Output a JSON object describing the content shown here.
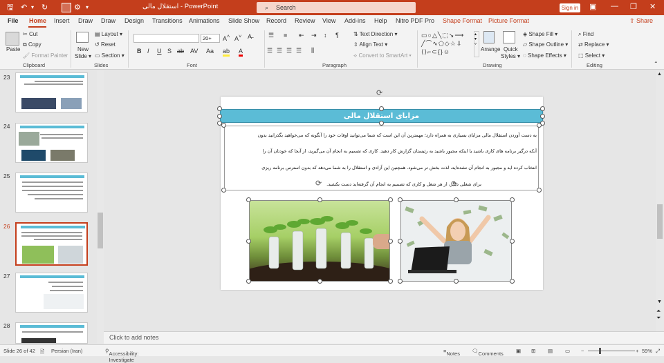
{
  "titlebar": {
    "doc_title": "استقلال مالی",
    "app": "PowerPoint",
    "search_placeholder": "Search",
    "signin": "Sign in"
  },
  "tabs": [
    "File",
    "Home",
    "Insert",
    "Draw",
    "Draw",
    "Design",
    "Transitions",
    "Animations",
    "Slide Show",
    "Record",
    "Review",
    "View",
    "Add-ins",
    "Help",
    "Nitro PDF Pro",
    "Shape Format",
    "Picture Format"
  ],
  "share": "Share",
  "ribbon": {
    "clipboard": {
      "paste": "Paste",
      "cut": "Cut",
      "copy": "Copy",
      "format_painter": "Format Painter",
      "label": "Clipboard"
    },
    "slides": {
      "new_slide": "New",
      "new_slide2": "Slide",
      "layout": "Layout",
      "reset": "Reset",
      "section": "Section",
      "label": "Slides"
    },
    "font": {
      "size": "20+",
      "label": "Font"
    },
    "paragraph": {
      "text_direction": "Text Direction",
      "align_text": "Align Text",
      "smartart": "Convert to SmartArt",
      "label": "Paragraph"
    },
    "drawing": {
      "arrange": "Arrange",
      "quick_styles": "Quick",
      "quick_styles2": "Styles",
      "shape_fill": "Shape Fill",
      "shape_outline": "Shape Outline",
      "shape_effects": "Shape Effects",
      "label": "Drawing"
    },
    "editing": {
      "find": "Find",
      "replace": "Replace",
      "select": "Select",
      "label": "Editing"
    }
  },
  "slides_panel": [
    {
      "num": "23"
    },
    {
      "num": "24"
    },
    {
      "num": "25"
    },
    {
      "num": "26"
    },
    {
      "num": "27"
    },
    {
      "num": "28"
    }
  ],
  "slide": {
    "title": "مزایای استقلال مالی",
    "lines": [
      "به دست آوردن استقلال مالی مزایای بسیاری به همراه دارد؛ مهمترین آن این است که شما می‌توانید اوقات خود را آنگونه که می‌خواهید بگذرانید بدون",
      "آنکه درگیر برنامه های کاری باشید یا اینکه مجبور باشید به رئیستان گزارش کار دهید. کاری که تصمیم به انجام آن می‌گیرید، از آنجا که خودتان آن را",
      "انتخاب کرده اید و مجبور به انجام آن نشده‌اید، لذت بخش تر می‌شود. همچنین این آزادی و استقلال را به شما می‌دهد که بدون استرس برنامه ریزی",
      "برای شغلی دیگر، از هر شغل و کاری که تصمیم به انجام آن گرفته‌اید دست بکشید."
    ]
  },
  "notes": "Click to add notes",
  "status": {
    "slide": "Slide 26 of 42",
    "lang": "Persian (Iran)",
    "accessibility": "Accessibility: Investigate",
    "notes": "Notes",
    "comments": "Comments",
    "zoom": "59%"
  },
  "colors": {
    "accent": "#c43e1c",
    "title_bar": "#5bbcd6"
  }
}
